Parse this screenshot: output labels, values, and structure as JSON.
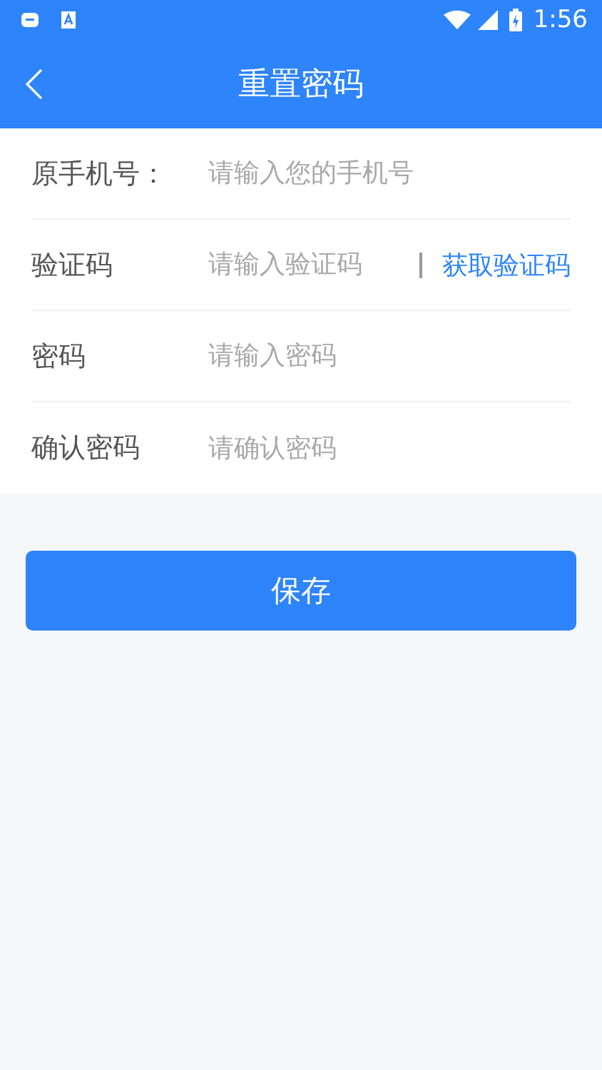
{
  "status_bar": {
    "time": "1:56"
  },
  "header": {
    "title": "重置密码"
  },
  "fields": [
    {
      "label": "原手机号：",
      "placeholder": "请输入您的手机号"
    },
    {
      "label": "验证码",
      "placeholder": "请输入验证码",
      "action": "获取验证码"
    },
    {
      "label": "密码",
      "placeholder": "请输入密码"
    },
    {
      "label": "确认密码",
      "placeholder": "请确认密码"
    }
  ],
  "save_button": "保存"
}
